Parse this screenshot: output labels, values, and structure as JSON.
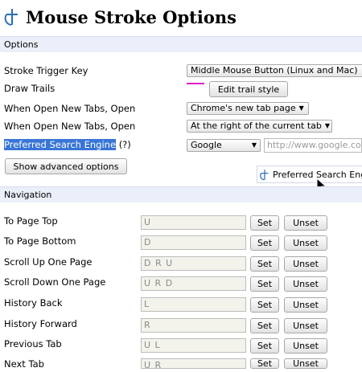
{
  "app": {
    "title": "Mouse Stroke Options",
    "accent_color": "#2a6fb8",
    "trail_color": "#e020c8"
  },
  "options": {
    "section_label": "Options",
    "stroke_trigger": {
      "label": "Stroke Trigger Key",
      "value": "Middle Mouse Button (Linux and Mac)"
    },
    "draw_trails": {
      "label": "Draw Trails",
      "button": "Edit trail style"
    },
    "open_new_tabs_1": {
      "label": "When Open New Tabs, Open",
      "value": "Chrome's new tab page"
    },
    "open_new_tabs_2": {
      "label": "When Open New Tabs, Open",
      "value": "At the right of the current tab"
    },
    "search_engine": {
      "label": "Preferred Search Engine",
      "help": "(?)",
      "value": "Google",
      "url": "http://www.google.co"
    },
    "advanced_button": "Show advanced options",
    "drag_ghost_label": "Preferred Search Eng"
  },
  "navigation": {
    "section_label": "Navigation",
    "set_label": "Set",
    "unset_label": "Unset",
    "rows": [
      {
        "label": "To Page Top",
        "stroke": "U"
      },
      {
        "label": "To Page Bottom",
        "stroke": "D"
      },
      {
        "label": "Scroll Up One Page",
        "stroke": "D R U"
      },
      {
        "label": "Scroll Down One Page",
        "stroke": "U R D"
      },
      {
        "label": "History Back",
        "stroke": "L"
      },
      {
        "label": "History Forward",
        "stroke": "R"
      },
      {
        "label": "Previous Tab",
        "stroke": "U L"
      },
      {
        "label": "Next Tab",
        "stroke": "U R"
      }
    ]
  }
}
